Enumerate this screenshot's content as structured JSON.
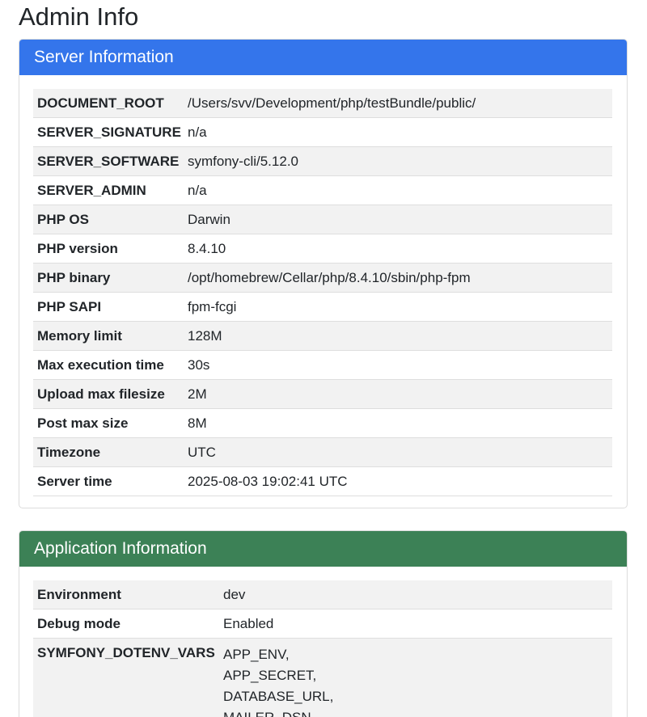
{
  "page": {
    "title": "Admin Info"
  },
  "server": {
    "header": "Server Information",
    "rows": [
      {
        "key": "DOCUMENT_ROOT",
        "value": "/Users/svv/Development/php/testBundle/public/"
      },
      {
        "key": "SERVER_SIGNATURE",
        "value": "n/a"
      },
      {
        "key": "SERVER_SOFTWARE",
        "value": "symfony-cli/5.12.0"
      },
      {
        "key": "SERVER_ADMIN",
        "value": "n/a"
      },
      {
        "key": "PHP OS",
        "value": "Darwin"
      },
      {
        "key": "PHP version",
        "value": "8.4.10"
      },
      {
        "key": "PHP binary",
        "value": "/opt/homebrew/Cellar/php/8.4.10/sbin/php-fpm"
      },
      {
        "key": "PHP SAPI",
        "value": "fpm-fcgi"
      },
      {
        "key": "Memory limit",
        "value": "128M"
      },
      {
        "key": "Max execution time",
        "value": "30s"
      },
      {
        "key": "Upload max filesize",
        "value": "2M"
      },
      {
        "key": "Post max size",
        "value": "8M"
      },
      {
        "key": "Timezone",
        "value": "UTC"
      },
      {
        "key": "Server time",
        "value": "2025-08-03 19:02:41 UTC"
      }
    ]
  },
  "app": {
    "header": "Application Information",
    "rows": [
      {
        "key": "Environment",
        "value": "dev"
      },
      {
        "key": "Debug mode",
        "value": "Enabled"
      }
    ],
    "dotenv": {
      "key": "SYMFONY_DOTENV_VARS",
      "values": [
        "APP_ENV,",
        "APP_SECRET,",
        "DATABASE_URL,",
        "MAILER_DSN,"
      ]
    }
  },
  "colors": {
    "server_header": "#3475eb",
    "app_header": "#3c8156"
  }
}
